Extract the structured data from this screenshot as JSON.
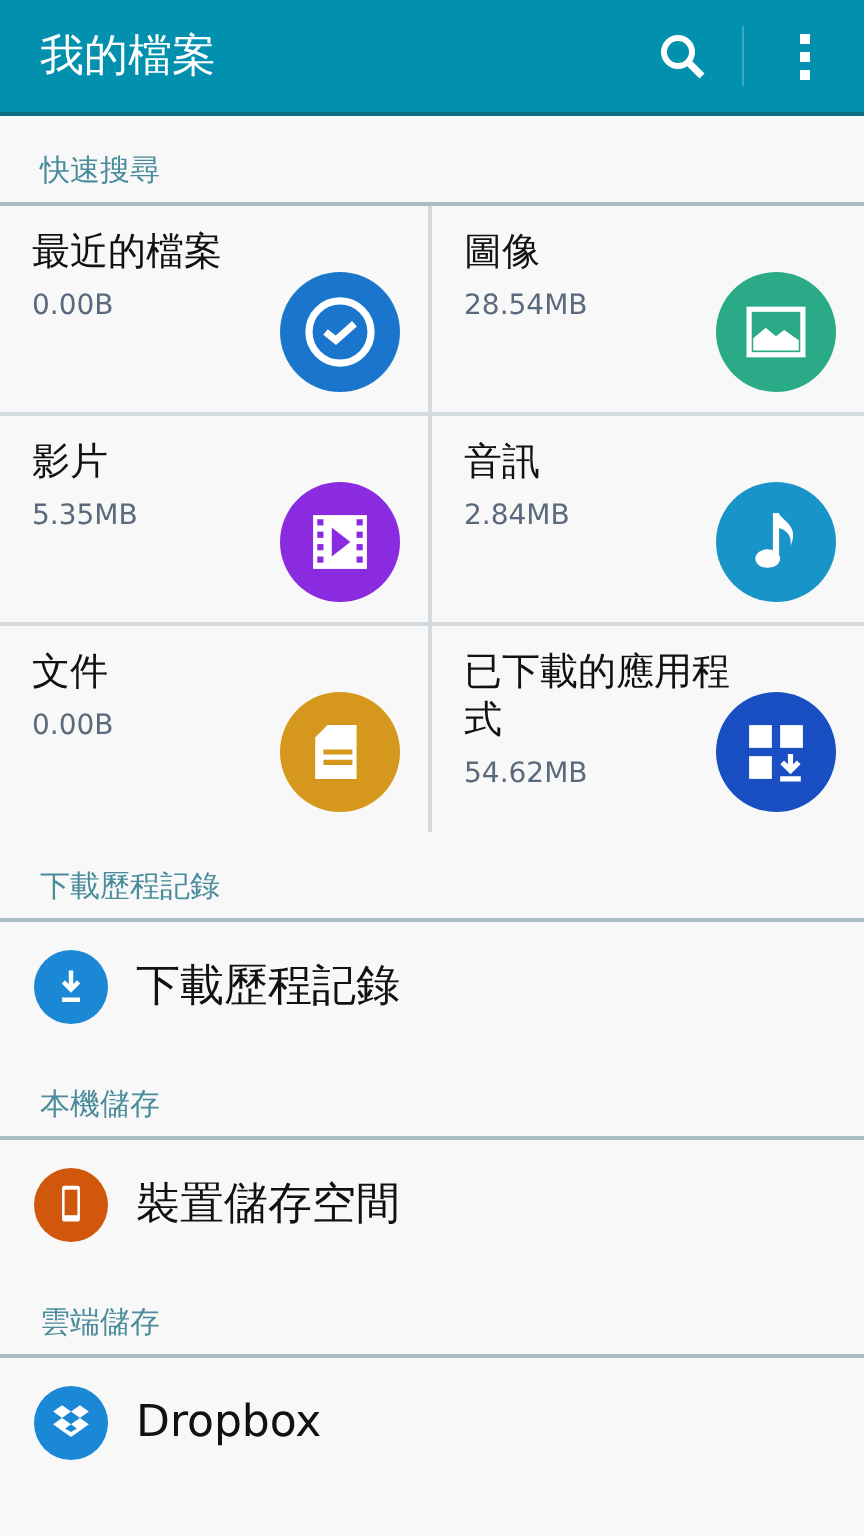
{
  "app_bar": {
    "title": "我的檔案"
  },
  "quick_search": {
    "header": "快速搜尋",
    "categories": [
      {
        "name": "最近的檔案",
        "size": "0.00B",
        "kind": "recent",
        "color": "#1976cc"
      },
      {
        "name": "圖像",
        "size": "28.54MB",
        "kind": "image",
        "color": "#2aaa86"
      },
      {
        "name": "影片",
        "size": "5.35MB",
        "kind": "video",
        "color": "#8a2be0"
      },
      {
        "name": "音訊",
        "size": "2.84MB",
        "kind": "audio",
        "color": "#1894c8"
      },
      {
        "name": "文件",
        "size": "0.00B",
        "kind": "document",
        "color": "#d6981c"
      },
      {
        "name": "已下載的應用程式",
        "size": "54.62MB",
        "kind": "apps",
        "color": "#1a4fc4"
      }
    ]
  },
  "sections": [
    {
      "header": "下載歷程記錄",
      "items": [
        {
          "label": "下載歷程記錄",
          "kind": "download",
          "color": "#1a88d4"
        }
      ]
    },
    {
      "header": "本機儲存",
      "items": [
        {
          "label": "裝置儲存空間",
          "kind": "device",
          "color": "#d0570c"
        }
      ]
    },
    {
      "header": "雲端儲存",
      "items": [
        {
          "label": "Dropbox",
          "kind": "dropbox",
          "color": "#1a88d4"
        }
      ]
    }
  ]
}
